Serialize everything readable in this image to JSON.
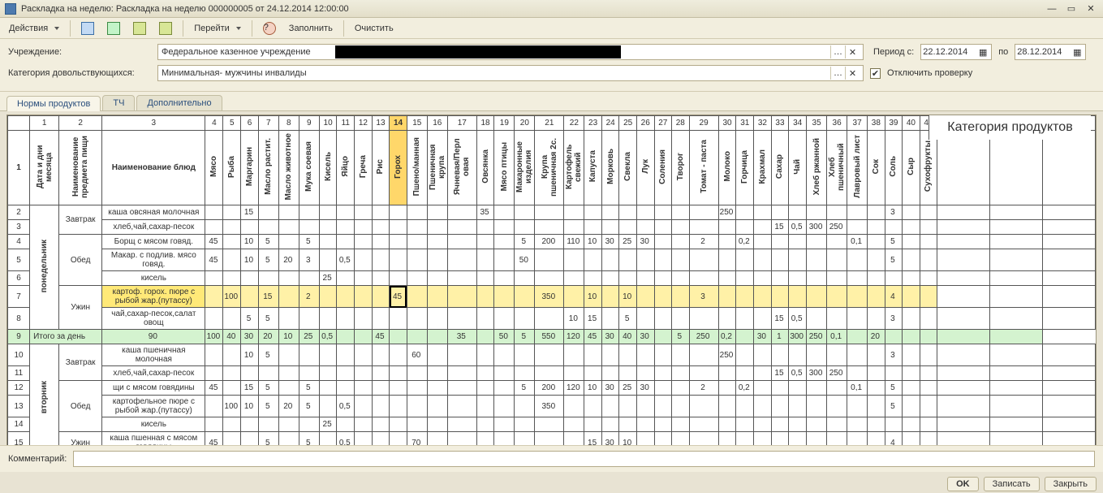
{
  "window": {
    "title": "Раскладка на неделю: Раскладка на неделю 000000005 от 24.12.2014 12:00:00"
  },
  "toolbar": {
    "actions": "Действия",
    "goto": "Перейти",
    "fill": "Заполнить",
    "clear": "Очистить"
  },
  "form": {
    "inst_label": "Учреждение:",
    "inst_value": "Федеральное казенное учреждение",
    "cat_label": "Категория довольствующихся:",
    "cat_value": "Минимальная- мужчины  инвалиды",
    "period_label": "Период с:",
    "period_from": "22.12.2014",
    "period_to_lbl": "по",
    "period_to": "28.12.2014",
    "disable_check": "Отключить проверку"
  },
  "tabs": {
    "t1": "Нормы продуктов",
    "t2": "ТЧ",
    "t3": "Дополнительно"
  },
  "grid": {
    "corner_label": "Категория продуктов",
    "h_date": "Дата и дни месяца",
    "h_item": "Наименование предмета пищи",
    "h_dish": "Наименование блюд",
    "cols": [
      "Мясо",
      "Рыба",
      "Маргарин",
      "Масло растит.",
      "Масло животное",
      "Мука соевая",
      "Кисель",
      "Яйцо",
      "Греча",
      "Рис",
      "Горох",
      "Пшено/манная",
      "Пшеничная крупа",
      "Ячневая/Перл овая",
      "Овсянка",
      "Мясо птицы",
      "Макаронные изделия",
      "Крупа пшеничная 2с.",
      "Картофель свежий",
      "Капуста",
      "Морковь",
      "Свекла",
      "Лук",
      "Соления",
      "Творог",
      "Томат - паста",
      "Молоко",
      "Горчица",
      "Крахмал",
      "Сахар",
      "Чай",
      "Хлеб ржанной",
      "Хлеб пшеничный",
      "Лавровый лист",
      "Сок",
      "Соль",
      "Сыр",
      "Сухофрукты"
    ],
    "day1": "понедельник",
    "day2": "вторник",
    "meal_bf": "Завтрак",
    "meal_ln": "Обед",
    "meal_dn": "Ужин",
    "total": "Итого за день",
    "rows": {
      "r2": {
        "dish": "каша овсяная молочная",
        "v": {
          "6": "15",
          "18": "35",
          "30": "250",
          "39": "3"
        }
      },
      "r3": {
        "dish": "хлеб,чай,сахар-песок",
        "v": {
          "33": "15",
          "34": "0,5",
          "35": "300",
          "36": "250"
        }
      },
      "r4": {
        "dish": "Борщ с мясом говяд.",
        "v": {
          "4": "45",
          "6": "10",
          "7": "5",
          "9": "5",
          "20": "5",
          "21": "200",
          "22": "110",
          "23": "10",
          "24": "30",
          "25": "25",
          "26": "30",
          "29": "2",
          "31": "0,2",
          "37": "0,1",
          "39": "5"
        }
      },
      "r5": {
        "dish": "Макар. с подлив. мясо говяд.",
        "v": {
          "4": "45",
          "6": "10",
          "7": "5",
          "8": "20",
          "9": "3",
          "11": "0,5",
          "20": "50",
          "39": "5"
        }
      },
      "r6": {
        "dish": "кисель",
        "v": {
          "10": "25"
        }
      },
      "r7": {
        "dish": "картоф. горох. пюре с рыбой жар.(путассу)",
        "v": {
          "5": "100",
          "7": "15",
          "9": "2",
          "14": "45",
          "21": "350",
          "23": "10",
          "25": "10",
          "29": "3",
          "39": "4"
        }
      },
      "r8": {
        "dish": "чай,сахар-песок,салат овощ",
        "v": {
          "6": "5",
          "7": "5",
          "22": "10",
          "23": "15",
          "25": "5",
          "33": "15",
          "34": "0,5",
          "39": "3"
        }
      },
      "r9": {
        "v": {
          "4": "90",
          "5": "100",
          "6": "40",
          "7": "30",
          "8": "20",
          "9": "10",
          "10": "25",
          "11": "0,5",
          "14": "45",
          "18": "35",
          "20": "50",
          "21": "5",
          "22": "550",
          "23": "120",
          "24": "45",
          "25": "30",
          "26": "40",
          "27": "30",
          "29": "5",
          "30": "250",
          "31": "0,2",
          "33": "30",
          "34": "1",
          "35": "300",
          "36": "250",
          "37": "0,1",
          "39": "20"
        }
      },
      "r10": {
        "dish": "каша пшеничная молочная",
        "v": {
          "6": "10",
          "7": "5",
          "15": "60",
          "30": "250",
          "39": "3"
        }
      },
      "r11": {
        "dish": "хлеб,чай,сахар-песок",
        "v": {
          "33": "15",
          "34": "0,5",
          "35": "300",
          "36": "250"
        }
      },
      "r12": {
        "dish": "щи с мясом говядины",
        "v": {
          "4": "45",
          "6": "15",
          "7": "5",
          "9": "5",
          "20": "5",
          "21": "200",
          "22": "120",
          "23": "10",
          "24": "30",
          "25": "25",
          "26": "30",
          "29": "2",
          "31": "0,2",
          "37": "0,1",
          "39": "5"
        }
      },
      "r13": {
        "dish": "картофельное пюре с рыбой жар.(путассу)",
        "v": {
          "5": "100",
          "6": "10",
          "7": "5",
          "8": "20",
          "9": "5",
          "11": "0,5",
          "21": "350",
          "39": "5"
        }
      },
      "r14": {
        "dish": "кисель",
        "v": {
          "10": "25"
        }
      },
      "r15": {
        "dish": "каша пшенная с мясом говядины",
        "v": {
          "4": "45",
          "7": "5",
          "9": "5",
          "11": "0,5",
          "15": "70",
          "23": "15",
          "24": "30",
          "25": "10",
          "39": "4"
        }
      }
    }
  },
  "bottom": {
    "comment_label": "Комментарий:"
  },
  "footer": {
    "ok": "OK",
    "write": "Записать",
    "close": "Закрыть"
  }
}
